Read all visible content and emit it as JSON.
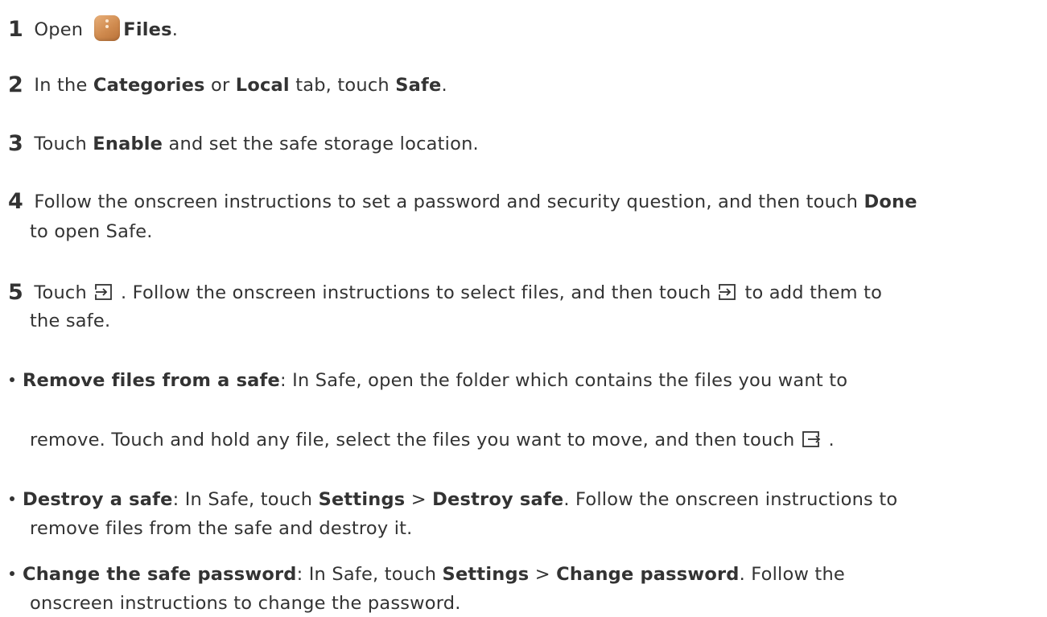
{
  "steps": [
    {
      "number": "1",
      "open_text": "Open",
      "app_icon": "files-app-icon",
      "app_name": "Files",
      "end": "."
    },
    {
      "number": "2",
      "t1": "In the",
      "categories": "Categories",
      "t2": "or",
      "local": "Local",
      "t3": "tab, touch",
      "safe": "Safe",
      "end": "."
    },
    {
      "number": "3",
      "t1": "Touch",
      "enable": "Enable",
      "t2": "and set the safe storage location."
    },
    {
      "number": "4",
      "t1": "Follow the onscreen instructions to set a password and security question, and then touch",
      "done": "Done",
      "t2": "to open Safe."
    },
    {
      "number": "5",
      "t1": "Touch",
      "icon1": "move-in-icon",
      "t2": ". Follow the onscreen instructions to select files, and then touch",
      "icon2": "move-in-icon",
      "t3": "to add them to",
      "t4": "the safe."
    }
  ],
  "bullets": [
    {
      "title": "Remove files from a safe",
      "t1": ": In Safe, open the folder which contains the files you want to",
      "t2": "remove. Touch and hold any file, select the files you want to move, and then touch",
      "icon": "move-out-icon",
      "t3": "."
    },
    {
      "title": "Destroy a safe",
      "t1": ": In Safe, touch",
      "settings": "Settings",
      "sep": ">",
      "destroy": "Destroy safe",
      "t2": ". Follow the onscreen instructions to",
      "t3": "remove files from the safe and destroy it."
    },
    {
      "title": "Change the safe password",
      "t1": ": In Safe, touch",
      "settings": "Settings",
      "sep": ">",
      "change": "Change password",
      "t2": ". Follow the",
      "t3": "onscreen instructions to change the password."
    }
  ]
}
